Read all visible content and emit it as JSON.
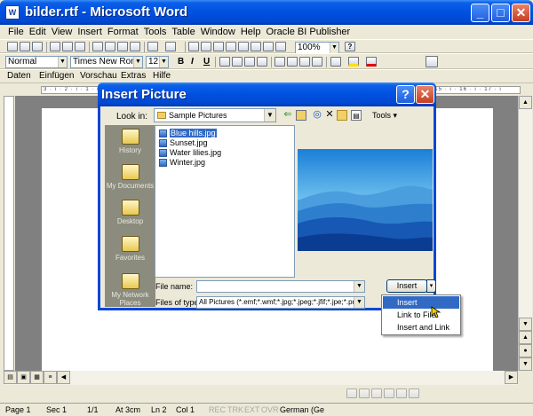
{
  "window": {
    "title": "bilder.rtf - Microsoft Word",
    "app_icon": "W",
    "buttons": {
      "minimize": "_",
      "maximize": "□",
      "close": "✕"
    }
  },
  "menu": [
    "File",
    "Edit",
    "View",
    "Insert",
    "Format",
    "Tools",
    "Table",
    "Window",
    "Help",
    "Oracle BI Publisher"
  ],
  "toolbar_standard": {
    "zoom": "100%",
    "help": "?"
  },
  "toolbar_formatting": {
    "style": "Normal",
    "font": "Times New Roman",
    "size": "12",
    "bold": "B",
    "italic": "I",
    "underline": "U"
  },
  "toolbar_extra": {
    "items": [
      "Daten",
      "Einfügen",
      "Vorschau",
      "Extras",
      "Hilfe"
    ]
  },
  "ruler_text": "3 · ı · 2 · ı · 1 · ı ·   · ı · 1 · ı · 2 · ı · 3 · ı · 4 · ı · 5 · ı · 6 · ı · 7 · ı · 8 · ı · 9 · ı · 10 · ı · 11 · ı · 12 · ı · 13 · ı · 14 · ı · 15 · ı · 16 · ı · 17 · ı",
  "status_bar": {
    "page": "Page 1",
    "sec": "Sec 1",
    "pages": "1/1",
    "at": "At 3cm",
    "ln": "Ln 2",
    "col": "Col 1",
    "rec": "REC",
    "trk": "TRK",
    "ext": "EXT",
    "ovr": "OVR",
    "lang": "German (Ge"
  },
  "dialog": {
    "title": "Insert Picture",
    "help_button": "?",
    "close_button": "✕",
    "look_in_label": "Look in:",
    "look_in_value": "Sample Pictures",
    "tools_label": "Tools",
    "places": [
      "History",
      "My Documents",
      "Desktop",
      "Favorites",
      "My Network Places"
    ],
    "files": [
      "Blue hills.jpg",
      "Sunset.jpg",
      "Water lilies.jpg",
      "Winter.jpg"
    ],
    "selected_file": "Blue hills.jpg",
    "file_name_label": "File name:",
    "file_name_value": "",
    "files_of_type_label": "Files of type:",
    "files_of_type_value": "All Pictures (*.emf;*.wmf;*.jpg;*.jpeg;*.jfif;*.jpe;*.png",
    "insert_button": "Insert",
    "insert_menu": [
      "Insert",
      "Link to File",
      "Insert and Link"
    ],
    "highlighted_menu_item": "Insert"
  },
  "colors": {
    "titlebar_blue": "#0050E0",
    "selection": "#316AC5",
    "places_bar": "#8c8c7e",
    "close_red": "#c43e1e"
  }
}
